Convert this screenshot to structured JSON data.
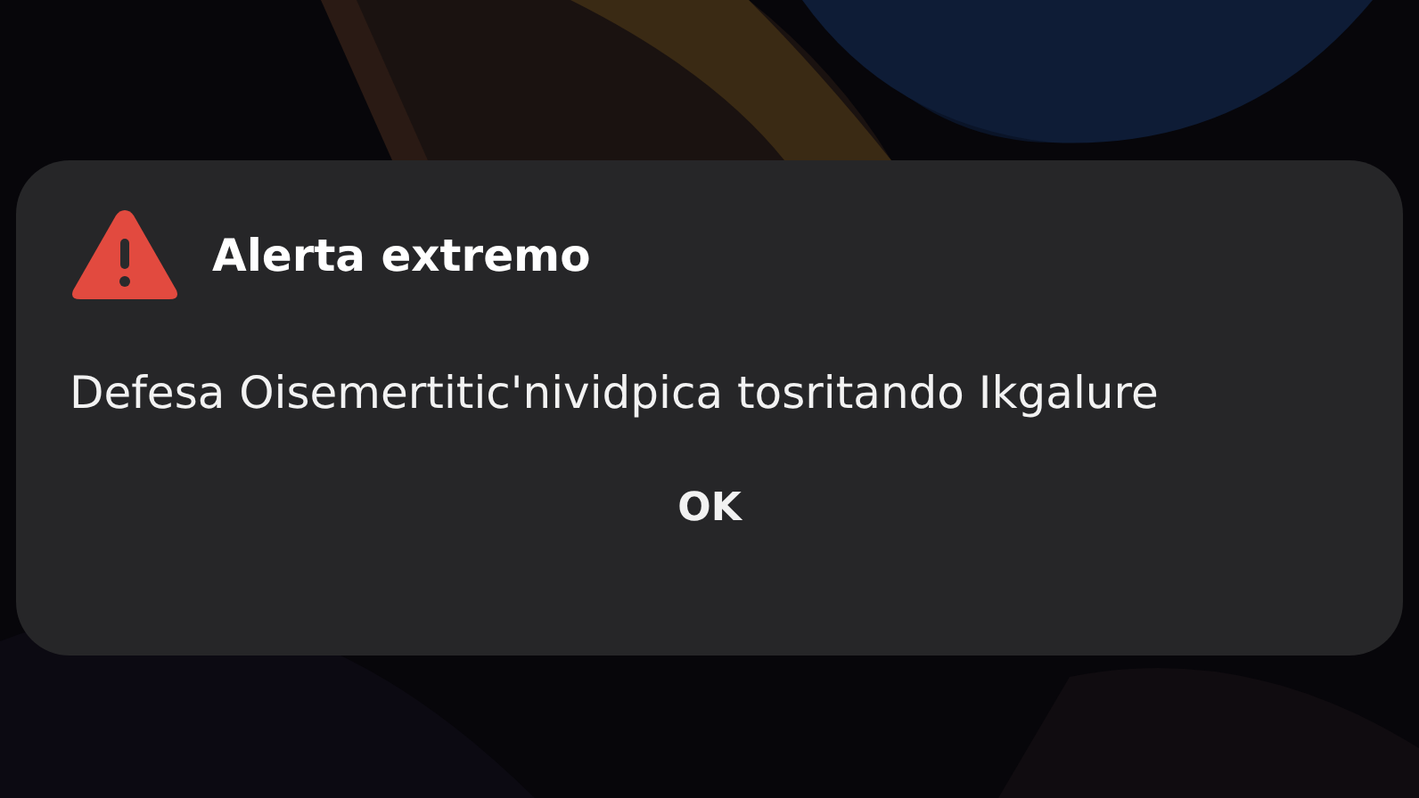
{
  "dialog": {
    "title": "Alerta extremo",
    "message": "Defesa Oisemertitic'nividpica tosritando Ikgalure",
    "buttons": [
      "OK"
    ]
  }
}
